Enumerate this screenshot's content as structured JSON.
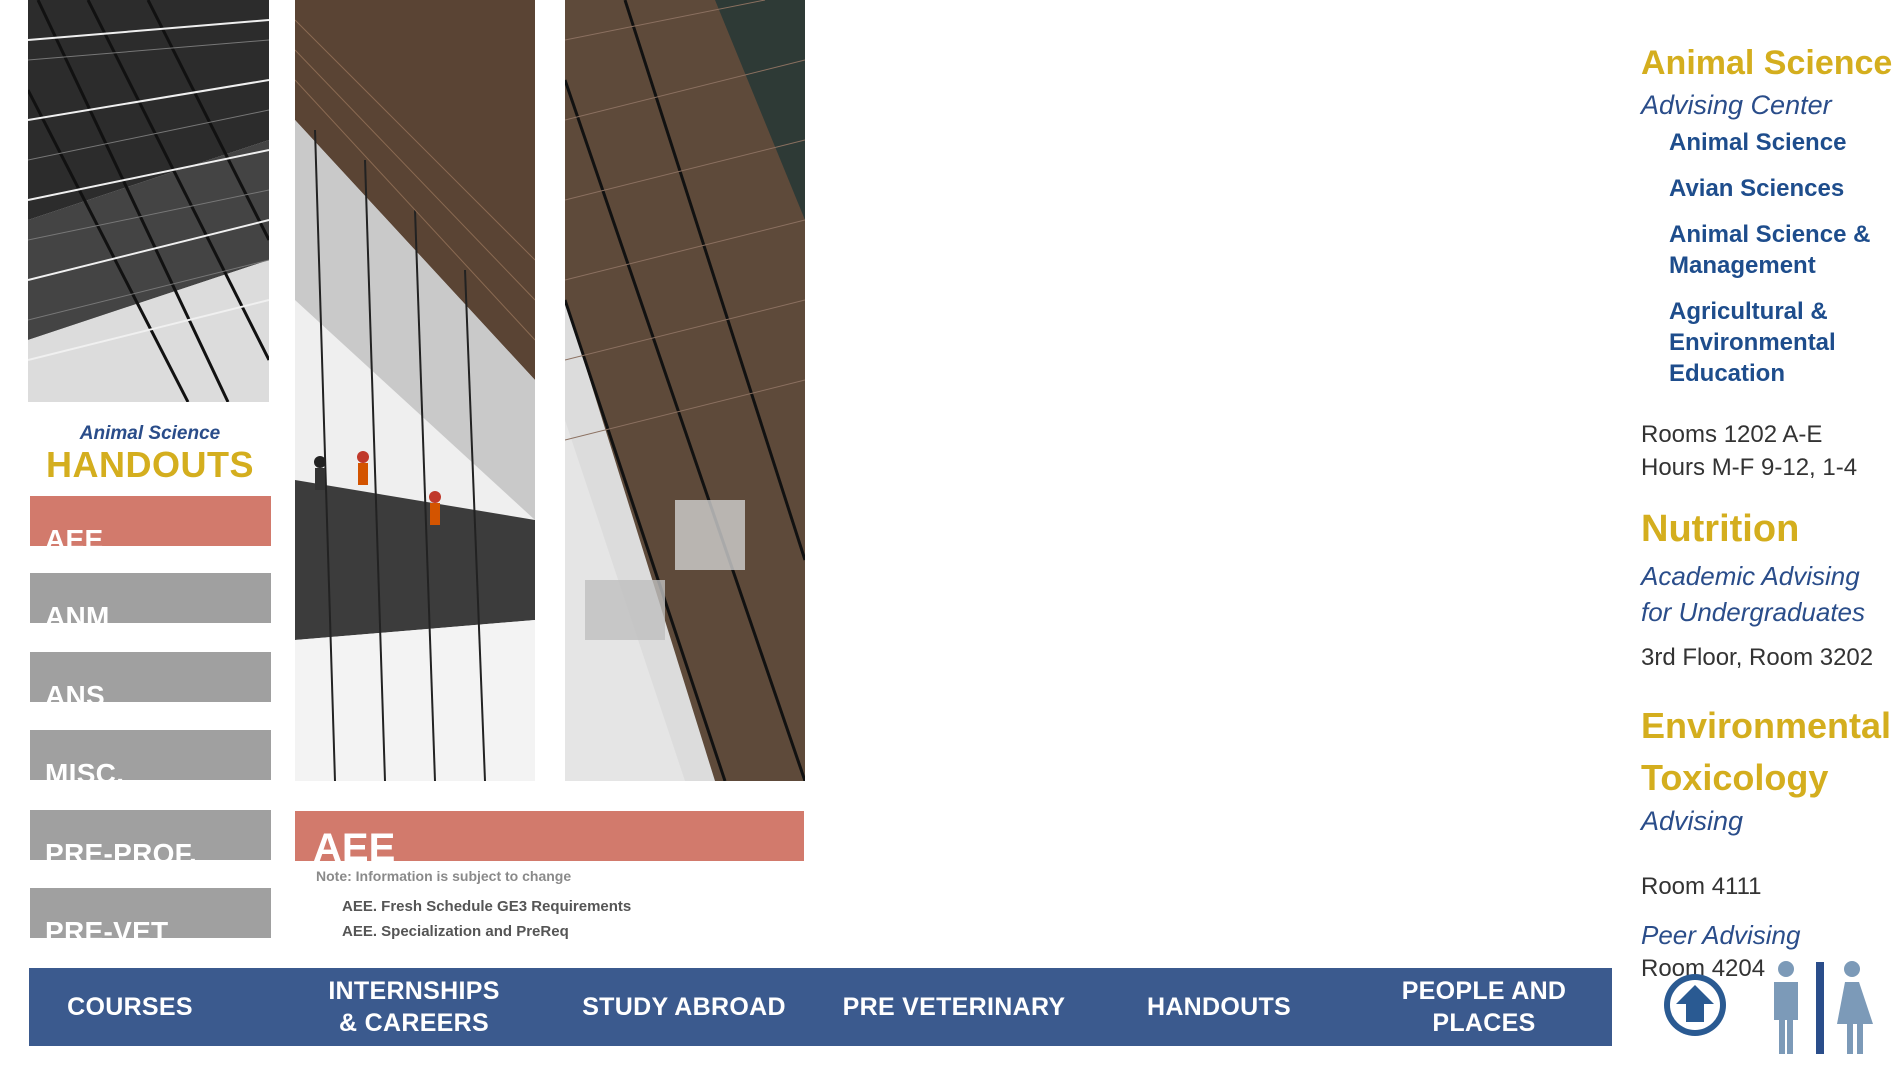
{
  "handouts": {
    "subtitle": "Animal Science",
    "title": "HANDOUTS",
    "categories": [
      {
        "label": "AEE",
        "color": "#d27a6c"
      },
      {
        "label": "ANM",
        "color": "#a0a0a0"
      },
      {
        "label": "ANS",
        "color": "#a0a0a0"
      },
      {
        "label": "MISC.",
        "color": "#a0a0a0"
      },
      {
        "label": "PRE-PROF.",
        "color": "#a0a0a0"
      },
      {
        "label": "PRE-VET",
        "color": "#a0a0a0"
      }
    ]
  },
  "content": {
    "heading": "AEE",
    "note": "Note: Information is subject to change",
    "documents": [
      "AEE. Fresh Schedule GE3 Requirements",
      "AEE. Specialization and PreReq"
    ]
  },
  "nav": {
    "items": [
      {
        "label": "COURSES"
      },
      {
        "label": "INTERNSHIPS & CAREERS"
      },
      {
        "label": "STUDY ABROAD"
      },
      {
        "label": "PRE VETERINARY"
      },
      {
        "label": "HANDOUTS"
      },
      {
        "label": "PEOPLE AND PLACES"
      }
    ],
    "bg_color": "#3b5a8e"
  },
  "sidebar": {
    "animal_science": {
      "title": "Animal Science",
      "subtitle": "Advising Center",
      "links": [
        "Animal Science",
        "Avian Sciences",
        "Animal Science & Management",
        "Agricultural & Environmental Education"
      ],
      "rooms": "Rooms 1202 A-E",
      "hours": "Hours M-F 9-12, 1-4"
    },
    "nutrition": {
      "title": "Nutrition",
      "subtitle": "Academic Advising for Undergraduates",
      "location": "3rd Floor, Room 3202"
    },
    "env_tox": {
      "title": "Environmental Toxicology",
      "subtitle": "Advising",
      "room": "Room 4111",
      "peer_label": "Peer Advising",
      "peer_room": "Room 4204"
    }
  },
  "icons": [
    "home-icon",
    "restroom-icon"
  ],
  "colors": {
    "gold": "#d4ae1e",
    "blue": "#2a4d8a",
    "salmon": "#d27a6c",
    "gray": "#a0a0a0"
  }
}
